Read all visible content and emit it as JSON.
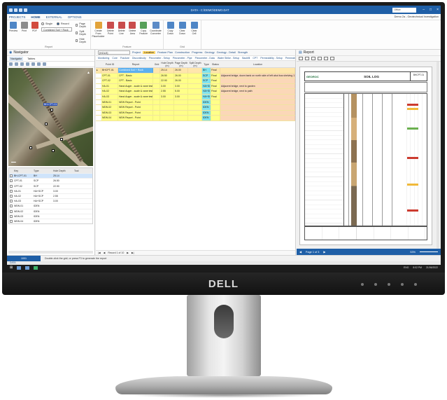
{
  "window": {
    "title": "DATA - C:\\DEMO\\DEMO.DAT",
    "search_label": "Office",
    "project_label": "Demo 2a - Geotechnical Investigation"
  },
  "menu": {
    "tabs": [
      "PROJECTS",
      "HOME",
      "EXTERNAL",
      "OPTIONS"
    ],
    "active": "HOME"
  },
  "ribbon": {
    "report_group": {
      "name": "Report",
      "buttons": [
        "Preview",
        "Print",
        "PDF"
      ],
      "radio_single": "Single",
      "radio_record": "Record",
      "combo_value": "Combined Soil + Rock",
      "checks": [
        "Page Depth",
        "Split Depth",
        "Hide Depth"
      ]
    },
    "feature_group": {
      "name": "Feature",
      "buttons": [
        "Create From Placeholder",
        "Delete Point",
        "Delete Line",
        "Delete Area",
        "Copy Feature",
        "Coordinate Converter"
      ]
    },
    "grid_group": {
      "name": "Grid",
      "buttons": [
        "Copy Down",
        "Clear Down",
        "Clear Cell"
      ]
    }
  },
  "navigator": {
    "title": "Navigator",
    "tabs": [
      "Navigator",
      "Tables"
    ],
    "map_labels": [
      "BH-CPT-01"
    ],
    "table": {
      "headers": [
        "",
        "Key",
        "Type",
        "Hole Depth",
        "Tool"
      ],
      "rows": [
        {
          "key": "BH-CPT-01",
          "type": "BH",
          "depth": "25.14"
        },
        {
          "key": "CPT-01",
          "type": "SCP",
          "depth": "26.50"
        },
        {
          "key": "CPT-02",
          "type": "SCP",
          "depth": "22.90"
        },
        {
          "key": "HA-01",
          "type": "HA+SCP",
          "depth": "3.00"
        },
        {
          "key": "HA-02",
          "type": "HA+SCP",
          "depth": "2.55"
        },
        {
          "key": "HA-03",
          "type": "HA+SCP",
          "depth": "3.00"
        },
        {
          "key": "NEW-01",
          "type": "IDEN",
          "depth": ""
        },
        {
          "key": "NEW-02",
          "type": "IDEN",
          "depth": ""
        },
        {
          "key": "NEW-03",
          "type": "IDEN",
          "depth": ""
        },
        {
          "key": "NEW-04",
          "type": "IDEN",
          "depth": ""
        }
      ]
    }
  },
  "grid": {
    "table_combo": "[HOLE]",
    "tabs_top": [
      "Project",
      "Location",
      "Feature Plan",
      "Construction",
      "Progress",
      "Geology",
      "Geology - Detail",
      "Strength"
    ],
    "active_tab": "Location",
    "tabs_second": [
      "Monitoring",
      "Core",
      "Fracture",
      "Discontinuity",
      "Piezometer - Setup",
      "Piezometer - Pipe",
      "Piezometer - Data",
      "Water Strike - Setup",
      "Backfill",
      "CPT",
      "Permeability - Setup",
      "Permeability - Data",
      "Sample"
    ],
    "headers": [
      "",
      "Point ID",
      "Report",
      "Grid",
      "Hole Depth (m)",
      "Page Depth (m)",
      "Split Depth (m)",
      "Type",
      "Status",
      "Location"
    ],
    "rows": [
      {
        "id": "BHCPT-01",
        "report": "Combined Soil + Rock",
        "hole": "25.14",
        "page": "26.00",
        "split": "",
        "type": "BH",
        "status": "Final",
        "loc": ""
      },
      {
        "id": "CPT-01",
        "report": "CPT - Basic",
        "hole": "26.50",
        "page": "26.00",
        "split": "",
        "type": "SCP",
        "status": "Final",
        "loc": "Adjacent bridge, down bank on north side of left abut bus shelving 100-03-1S."
      },
      {
        "id": "CPT-02",
        "report": "CPT - Basic",
        "hole": "22.90",
        "page": "26.00",
        "split": "",
        "type": "SCP",
        "status": "Final",
        "loc": ""
      },
      {
        "id": "HA-01",
        "report": "Hand Auger - scale & vane test",
        "hole": "3.00",
        "page": "3.00",
        "split": "",
        "type": "HA+SCP",
        "status": "Final",
        "loc": "Adjacent bridge, next to garden"
      },
      {
        "id": "HA-02",
        "report": "Hand Auger - scale & vane test",
        "hole": "2.55",
        "page": "5.00",
        "split": "",
        "type": "HA+SCP",
        "status": "Final",
        "loc": "Adjacent bridge, next to path"
      },
      {
        "id": "HA-03",
        "report": "Hand Auger - scale & vane test",
        "hole": "3.00",
        "page": "3.00",
        "split": "",
        "type": "HA+SCP",
        "status": "Final",
        "loc": ""
      },
      {
        "id": "NEW-01",
        "report": "NEW Report - Point",
        "hole": "",
        "page": "",
        "split": "",
        "type": "IDEN",
        "status": "",
        "loc": ""
      },
      {
        "id": "NEW-02",
        "report": "NEW Report - Point",
        "hole": "",
        "page": "",
        "split": "",
        "type": "IDEN",
        "status": "",
        "loc": ""
      },
      {
        "id": "NEW-03",
        "report": "NEW Report - Point",
        "hole": "",
        "page": "",
        "split": "",
        "type": "IDEN",
        "status": "",
        "loc": ""
      },
      {
        "id": "NEW-04",
        "report": "NEW Report - Point",
        "hole": "",
        "page": "",
        "split": "",
        "type": "IDEN",
        "status": "",
        "loc": ""
      }
    ],
    "record_label": "Record 1 of 10"
  },
  "report": {
    "title": "Report",
    "company": "GEOROC",
    "sheet_title": "SOIL LOG",
    "hole_id": "BHCPT-01",
    "page_label": "Page 1 of 3",
    "zoom": "53%"
  },
  "status": {
    "left": "1001",
    "message": "Double-click the grid, or press F3 to generate the report"
  },
  "bottom_tab": "DATA",
  "taskbar": {
    "time": "8:02 PM",
    "date": "21/06/2022",
    "lang": "ENG"
  },
  "monitor": {
    "brand": "DELL"
  },
  "colors": {
    "accent": "#1f5fa7",
    "row_yellow": "#ffff88",
    "row_salmon": "#fbd7b8",
    "type_cyan": "#7fe4f0"
  }
}
